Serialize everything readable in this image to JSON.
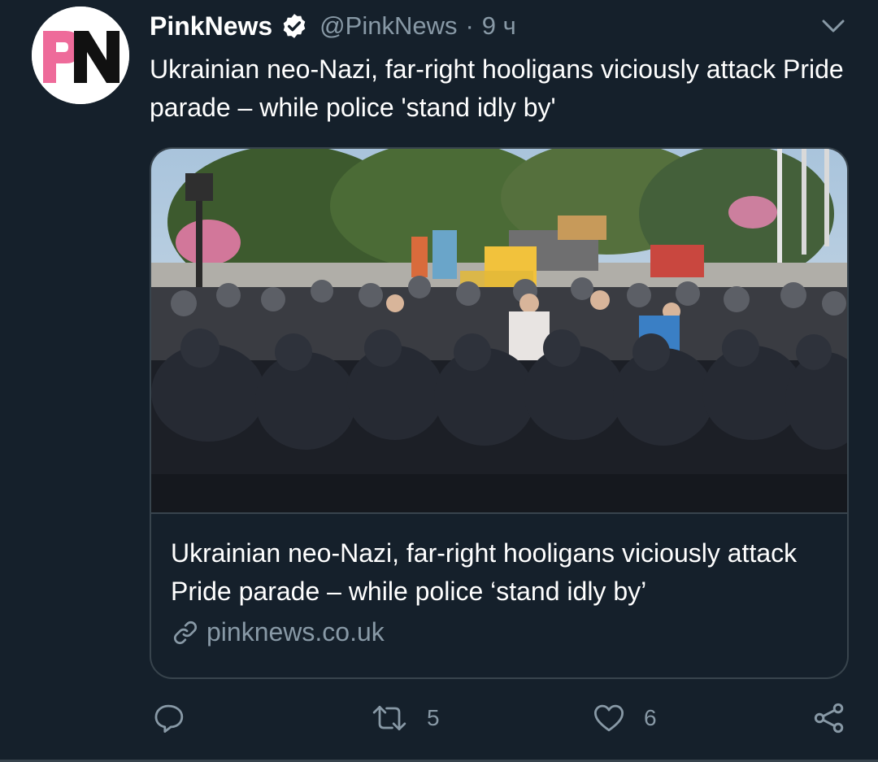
{
  "author": {
    "name": "PinkNews",
    "handle": "@PinkNews",
    "separator": "·",
    "time": "9 ч",
    "avatar_letters": "PN"
  },
  "tweet": {
    "text": "Ukrainian neo-Nazi, far-right hooligans viciously attack Pride parade – while police 'stand idly by'"
  },
  "card": {
    "title": "Ukrainian neo-Nazi, far-right hooligans viciously attack Pride parade – while police ‘stand idly by’",
    "domain": "pinknews.co.uk"
  },
  "actions": {
    "reply_count": "",
    "retweet_count": "5",
    "like_count": "6"
  },
  "colors": {
    "background": "#15202b",
    "border": "#38444d",
    "secondary_text": "#8899a6",
    "brand_pink": "#ee6b9a"
  },
  "icons": {
    "verified": "verified-badge-icon",
    "caret": "chevron-down-icon",
    "link": "link-icon",
    "reply": "reply-icon",
    "retweet": "retweet-icon",
    "like": "heart-icon",
    "share": "share-icon"
  }
}
